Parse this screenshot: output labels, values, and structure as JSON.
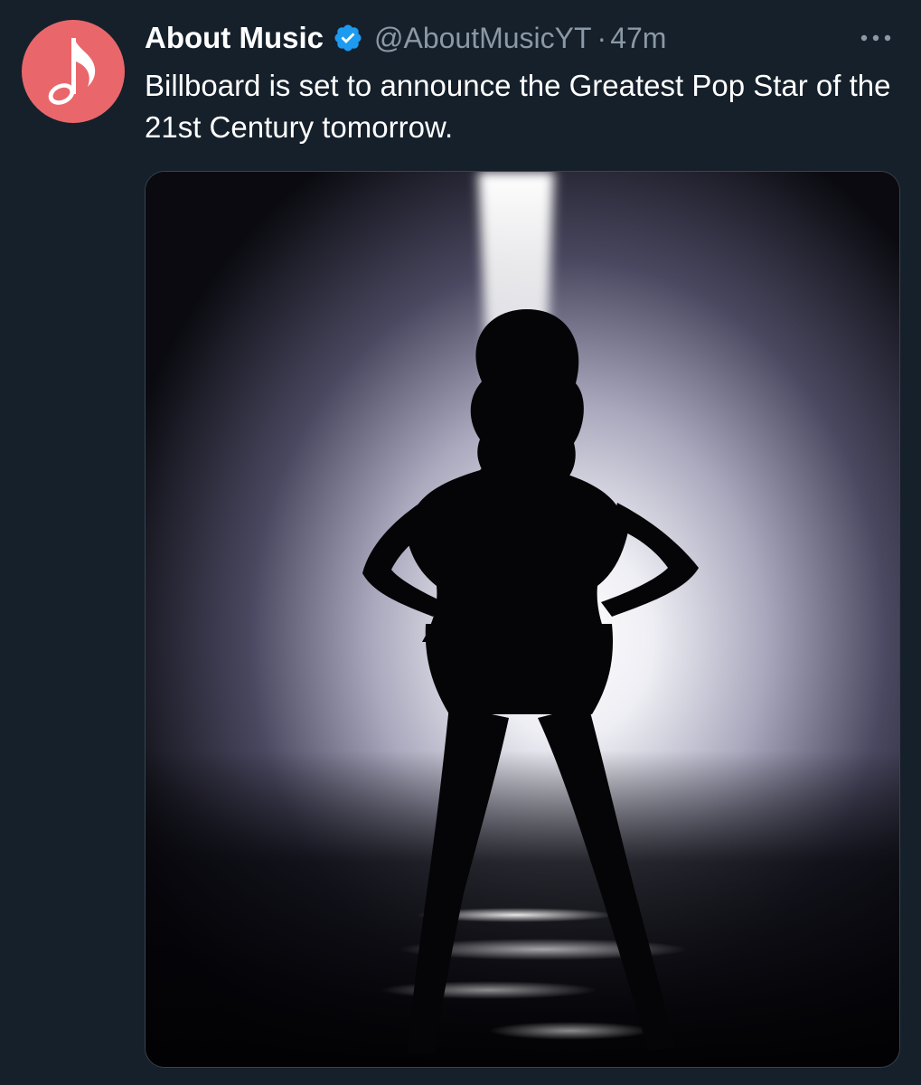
{
  "tweet": {
    "author": {
      "display_name": "About Music",
      "handle": "@AboutMusicYT",
      "verified": true,
      "avatar_icon": "music-note-icon",
      "avatar_color": "#e9676b"
    },
    "separator": "·",
    "time": "47m",
    "text": "Billboard is set to announce the Greatest Pop Star of the 21st Century tomorrow.",
    "more_icon": "more-dots-icon"
  },
  "colors": {
    "background": "#15202b",
    "text": "#ffffff",
    "secondary_text": "#8b98a5",
    "verified_badge": "#1d9bf0",
    "media_border": "#38444d"
  }
}
